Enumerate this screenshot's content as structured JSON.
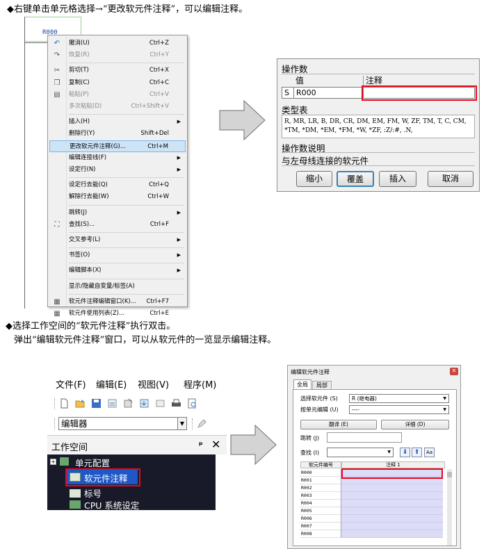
{
  "step1": {
    "text": "◆右键单击单元格选择→“更改软元件注释”，可以编辑注释。"
  },
  "ladder": {
    "cell_label": "R000"
  },
  "context_menu": {
    "items": [
      {
        "icon": "undo-icon",
        "glyph": "↶",
        "label": "撤消(U)",
        "shortcut": "Ctrl+Z",
        "disabled": false,
        "submenu": false
      },
      {
        "icon": "redo-icon",
        "glyph": "↷",
        "label": "恢复(R)",
        "shortcut": "Ctrl+Y",
        "disabled": true,
        "submenu": false
      },
      {
        "icon": "cut-icon",
        "glyph": "✂",
        "label": "剪切(T)",
        "shortcut": "Ctrl+X",
        "disabled": false,
        "submenu": false
      },
      {
        "icon": "copy-icon",
        "glyph": "❐",
        "label": "复制(C)",
        "shortcut": "Ctrl+C",
        "disabled": false,
        "submenu": false
      },
      {
        "icon": "paste-icon",
        "glyph": "▤",
        "label": "粘贴(P)",
        "shortcut": "Ctrl+V",
        "disabled": true,
        "submenu": false
      },
      {
        "icon": "",
        "glyph": "",
        "label": "多次粘贴(D)",
        "shortcut": "Ctrl+Shift+V",
        "disabled": true,
        "submenu": false
      },
      {
        "icon": "",
        "glyph": "",
        "label": "插入(H)",
        "shortcut": "",
        "disabled": false,
        "submenu": true
      },
      {
        "icon": "",
        "glyph": "",
        "label": "删除行(Y)",
        "shortcut": "Shift+Del",
        "disabled": false,
        "submenu": false
      },
      {
        "icon": "",
        "glyph": "",
        "label": "更改软元件注释(G)...",
        "shortcut": "Ctrl+M",
        "disabled": false,
        "submenu": false,
        "highlighted": true
      },
      {
        "icon": "",
        "glyph": "",
        "label": "编辑连接线(F)",
        "shortcut": "",
        "disabled": false,
        "submenu": true
      },
      {
        "icon": "",
        "glyph": "",
        "label": "设定行(N)",
        "shortcut": "",
        "disabled": false,
        "submenu": true
      },
      {
        "icon": "",
        "glyph": "",
        "label": "设定行去能(Q)",
        "shortcut": "Ctrl+Q",
        "disabled": false,
        "submenu": false
      },
      {
        "icon": "",
        "glyph": "",
        "label": "解除行去能(W)",
        "shortcut": "Ctrl+W",
        "disabled": false,
        "submenu": false
      },
      {
        "icon": "",
        "glyph": "",
        "label": "跳转(J)",
        "shortcut": "",
        "disabled": false,
        "submenu": true
      },
      {
        "icon": "binoculars-icon",
        "glyph": "⛶",
        "label": "查找(S)...",
        "shortcut": "Ctrl+F",
        "disabled": false,
        "submenu": false
      },
      {
        "icon": "",
        "glyph": "",
        "label": "交叉参考(L)",
        "shortcut": "",
        "disabled": false,
        "submenu": true
      },
      {
        "icon": "",
        "glyph": "",
        "label": "书签(O)",
        "shortcut": "",
        "disabled": false,
        "submenu": true
      },
      {
        "icon": "",
        "glyph": "",
        "label": "编辑脚本(X)",
        "shortcut": "",
        "disabled": false,
        "submenu": true
      },
      {
        "icon": "",
        "glyph": "",
        "label": "显示/隐藏自变量/标签(A)",
        "shortcut": "",
        "disabled": false,
        "submenu": false
      },
      {
        "icon": "grid-icon",
        "glyph": "▦",
        "label": "软元件注释编辑窗口(K)...",
        "shortcut": "Ctrl+F7",
        "disabled": false,
        "submenu": false
      },
      {
        "icon": "list-icon",
        "glyph": "▦",
        "label": "软元件使用列表(Z)...",
        "shortcut": "Ctrl+E",
        "disabled": false,
        "submenu": false
      }
    ]
  },
  "operand_dialog": {
    "title": "操作数",
    "col_value": "值",
    "col_comment": "注释",
    "row_type": "S",
    "row_value": "R000",
    "row_comment": "",
    "type_table_title": "类型表",
    "type_table_line1": "R, MR, LR, B, DR, CR, DM, EM, FM, W, ZF, TM, T, C, CM,",
    "type_table_line2": "*TM, *DM, *EM, *FM, *W, *ZF, :Z/:#, .N,",
    "desc_title": "操作数说明",
    "desc_text": "与左母线连接的软元件",
    "buttons": {
      "shrink": "缩小",
      "overwrite": "覆盖",
      "insert": "插入",
      "cancel": "取消"
    }
  },
  "step2": {
    "line1": "◆选择工作空间的“软元件注释”执行双击。",
    "line2": "弹出“编辑软元件注释”窗口，可以从软元件的一览显示编辑注释。"
  },
  "menubar": {
    "file": "文件(F)",
    "edit": "编辑(E)",
    "view": "视图(V)",
    "program": "程序(M)"
  },
  "editor_combo": {
    "value": "编辑器"
  },
  "workspace": {
    "title": "工作空间",
    "pin": "ᵖ",
    "close": "×",
    "tree": [
      {
        "label": "单元配置"
      },
      {
        "label": "软元件注释"
      },
      {
        "label": "标号"
      },
      {
        "label": "CPU 系统设定"
      }
    ]
  },
  "device_comment_dialog": {
    "title": "编辑软元件注释",
    "tabs": [
      "全局",
      "局部"
    ],
    "select_device_label": "选择软元件 (S)",
    "select_device_value": "R (继电器)",
    "per_unit_label": "按单元编辑 (U)",
    "per_unit_value": "----",
    "translate_btn": "翻译 (E)",
    "detail_btn": "详细 (D)",
    "jump_label": "跳转 (J)",
    "find_label": "查找 (I)",
    "col_device": "软元件编号",
    "col_comment": "注释 1",
    "rows": [
      "R000",
      "R001",
      "R002",
      "R003",
      "R004",
      "R005",
      "R006",
      "R007",
      "R008"
    ]
  }
}
